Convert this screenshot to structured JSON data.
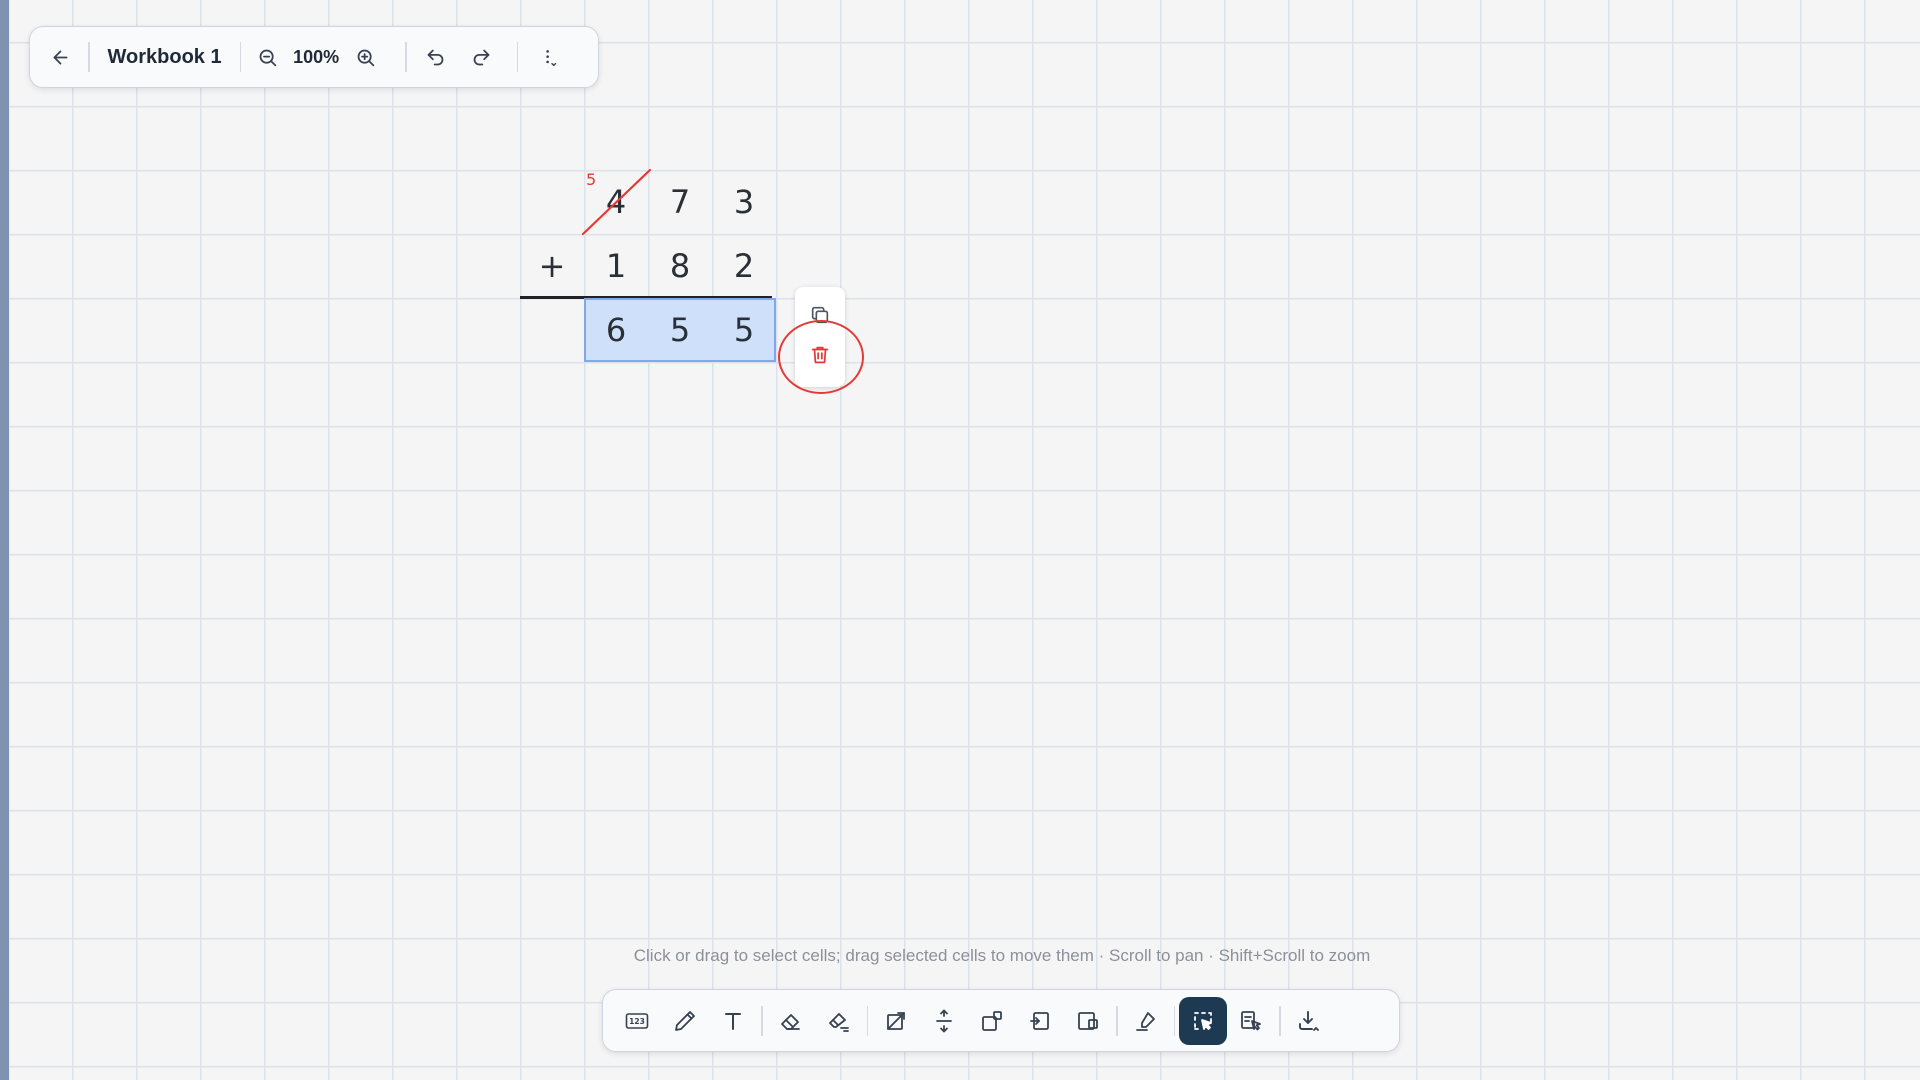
{
  "workbook": {
    "title": "Workbook 1",
    "zoom": "100%"
  },
  "worksheet": {
    "operator": "+",
    "top_row": [
      "4",
      "7",
      "3"
    ],
    "second_row": [
      "1",
      "8",
      "2"
    ],
    "result_row": [
      "6",
      "5",
      "5"
    ],
    "carry_mark": "5",
    "struck_digit": "4",
    "colors": {
      "carry": "#e53935",
      "selection_fill": "#cfe0fb",
      "selection_border": "#7fa8ee"
    }
  },
  "selection_actions": {
    "items": [
      {
        "name": "copy-icon",
        "color": "#4b5563"
      },
      {
        "name": "trash-icon",
        "color": "#e53935"
      }
    ],
    "annotation_color": "#e53935"
  },
  "hint_text": "Click or drag to select cells; drag selected cells to move them · Scroll to pan · Shift+Scroll to zoom",
  "bottom_toolbar": {
    "number_tool_label": "123",
    "active_tool": "select-cells",
    "active_color": "#1e3a52"
  }
}
